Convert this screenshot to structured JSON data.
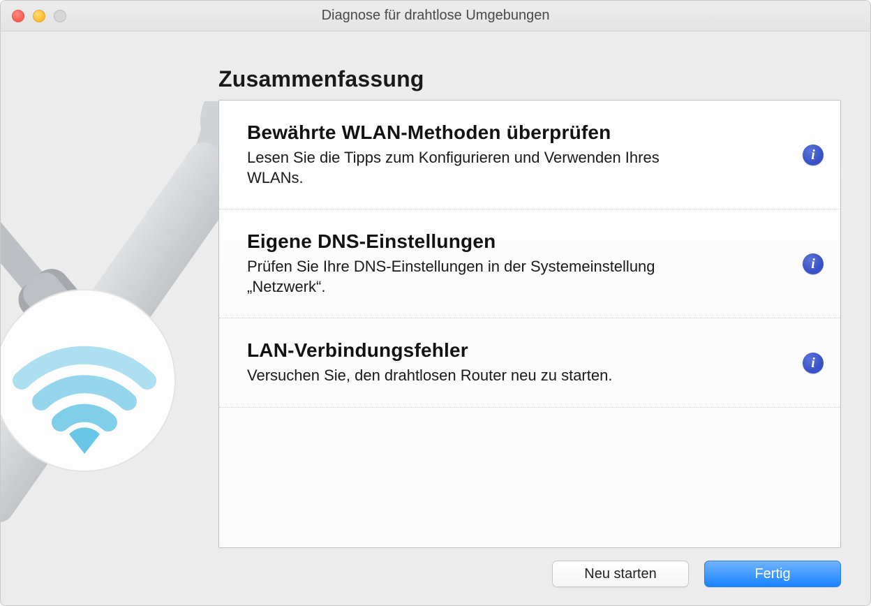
{
  "window": {
    "title": "Diagnose für drahtlose Umgebungen"
  },
  "heading": "Zusammenfassung",
  "items": [
    {
      "title": "Bewährte WLAN-Methoden überprüfen",
      "subtitle": "Lesen Sie die Tipps zum Konfigurieren und Verwenden Ihres WLANs.",
      "info_glyph": "i"
    },
    {
      "title": "Eigene DNS-Einstellungen",
      "subtitle": "Prüfen Sie Ihre DNS-Einstellungen in der Systemeinstellung „Netzwerk“.",
      "info_glyph": "i"
    },
    {
      "title": "LAN-Verbindungsfehler",
      "subtitle": "Versuchen Sie, den drahtlosen Router neu zu starten.",
      "info_glyph": "i"
    }
  ],
  "buttons": {
    "restart": "Neu starten",
    "done": "Fertig"
  }
}
